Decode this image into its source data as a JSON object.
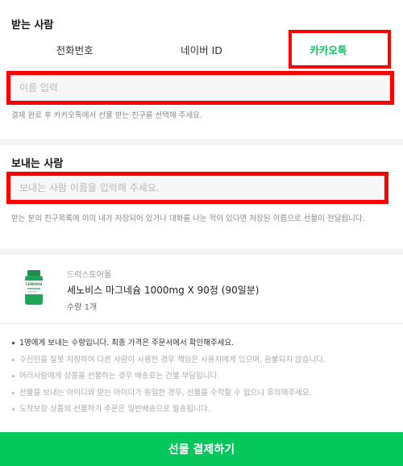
{
  "receiver": {
    "title": "받는 사람",
    "tabs": [
      {
        "label": "전화번호"
      },
      {
        "label": "네이버 ID"
      },
      {
        "label": "카카오톡"
      }
    ],
    "name_placeholder": "이름 입력",
    "help": "결제 완료 후 카카오톡에서 선물 받는 친구를 선택해 주세요."
  },
  "sender": {
    "title": "보내는 사람",
    "name_placeholder": "보내는 사람 이름을 입력해 주세요.",
    "help": "받는 분의 친구목록에 이미 내가 저장되어 있거나 대화를 나눈 적이 있다면 저장된 이름으로 선물이 전달됩니다."
  },
  "product": {
    "store": "드럭스토어몰",
    "name": "세노비스 마그네슘 1000mg X 90정 (90일분)",
    "quantity": "수량 1개",
    "thumb_brand": "CENOVIS"
  },
  "notices": [
    "1명에게 보내는 수량입니다. 최종 가격은 주문서에서 확인해주세요.",
    "수신인을 잘못 지정하여 다른 사람이 사용한 경우 책임은 사용자에게 있으며, 환불되지 않습니다.",
    "여러사람에게 상품을 선물하는 경우 배송료는 건별 부담됩니다.",
    "선물을 보내는 아이디와 받는 아이디가 동일한 경우, 선물을 수락할 수 없으니 유의해주세요.",
    "도착보장 상품의 선물하기 주문은 일반배송으로 발송됩니다."
  ],
  "pay_button": "선물 결제하기",
  "colors": {
    "accent": "#03c75a",
    "highlight": "#ff0000"
  }
}
